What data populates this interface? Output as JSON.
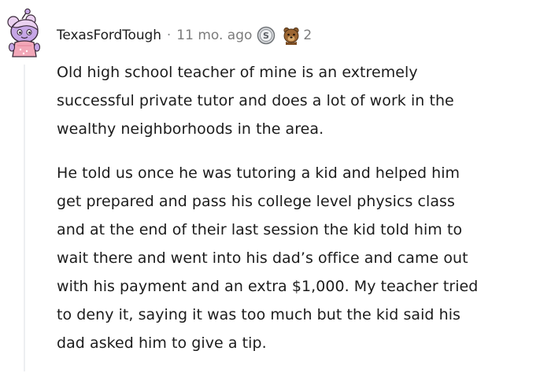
{
  "comment": {
    "username": "TexasFordTough",
    "separator": "·",
    "timestamp": "11 mo. ago",
    "awards": {
      "silver_icon": "silver-award-icon",
      "bear_icon": "bear-award-icon",
      "count": "2"
    },
    "avatar_icon": "snoo-avatar-icon",
    "paragraphs": [
      {
        "lines": [
          "Old high school teacher of mine is an extremely",
          "successful private tutor and does a lot of work in the",
          "wealthy neighborhoods in the area."
        ]
      },
      {
        "lines": [
          "He told us once he was tutoring a kid and helped him",
          "get prepared and pass his college level physics class",
          "and at the end of their last session the kid told him to",
          "wait there and went into his dad’s office and came out",
          "with his payment and an extra $1,000. My teacher tried",
          "to deny it, saying it was too much but the kid said his",
          "dad asked him to give a tip."
        ]
      }
    ]
  },
  "colors": {
    "text": "#1c1c1c",
    "meta": "#7c7c7c",
    "thread_line": "#edeff1",
    "avatar_body": "#c6a6e6",
    "avatar_hair": "#ead1f0"
  }
}
